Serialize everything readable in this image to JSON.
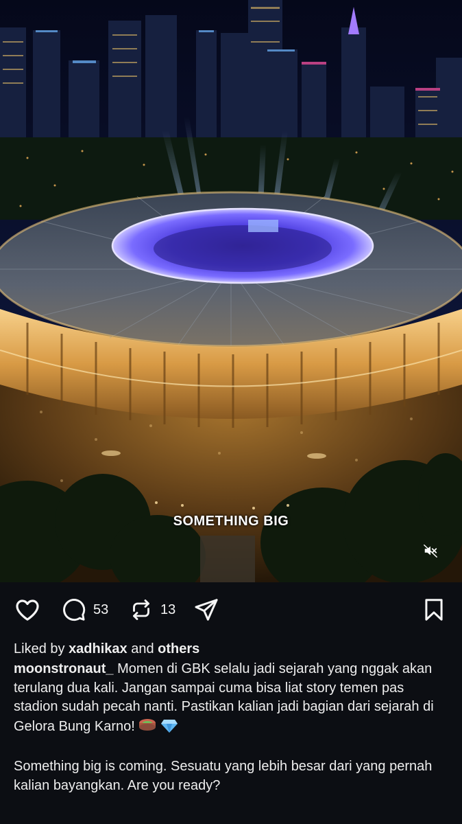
{
  "media": {
    "overlay_text": "SOMETHING BIG",
    "mute_icon": "speaker-muted-icon"
  },
  "actions": {
    "like_icon": "heart-icon",
    "comment_icon": "comment-bubble-icon",
    "comment_count": "53",
    "repost_icon": "repost-icon",
    "repost_count": "13",
    "share_icon": "send-icon",
    "save_icon": "bookmark-icon"
  },
  "likes": {
    "prefix": "Liked by ",
    "user": "xadhikax",
    "middle": " and ",
    "others": "others"
  },
  "caption": {
    "username": "moonstronaut_",
    "paragraph1": "Momen di GBK selalu jadi sejarah yang nggak akan terulang dua kali. Jangan sampai cuma bisa liat story temen pas stadion sudah pecah nanti. Pastikan kalian jadi bagian dari sejarah di Gelora Bung Karno!",
    "emoji1": "stadium-emoji",
    "emoji2": "gem-emoji",
    "paragraph2": "Something big is coming. Sesuatu yang lebih besar dari yang pernah kalian bayangkan. Are you ready?"
  },
  "colors": {
    "background": "#0c0e13",
    "text": "#f5f5f5",
    "stadium_glow": "#f2b45a",
    "stage_light": "#6a5cff"
  }
}
